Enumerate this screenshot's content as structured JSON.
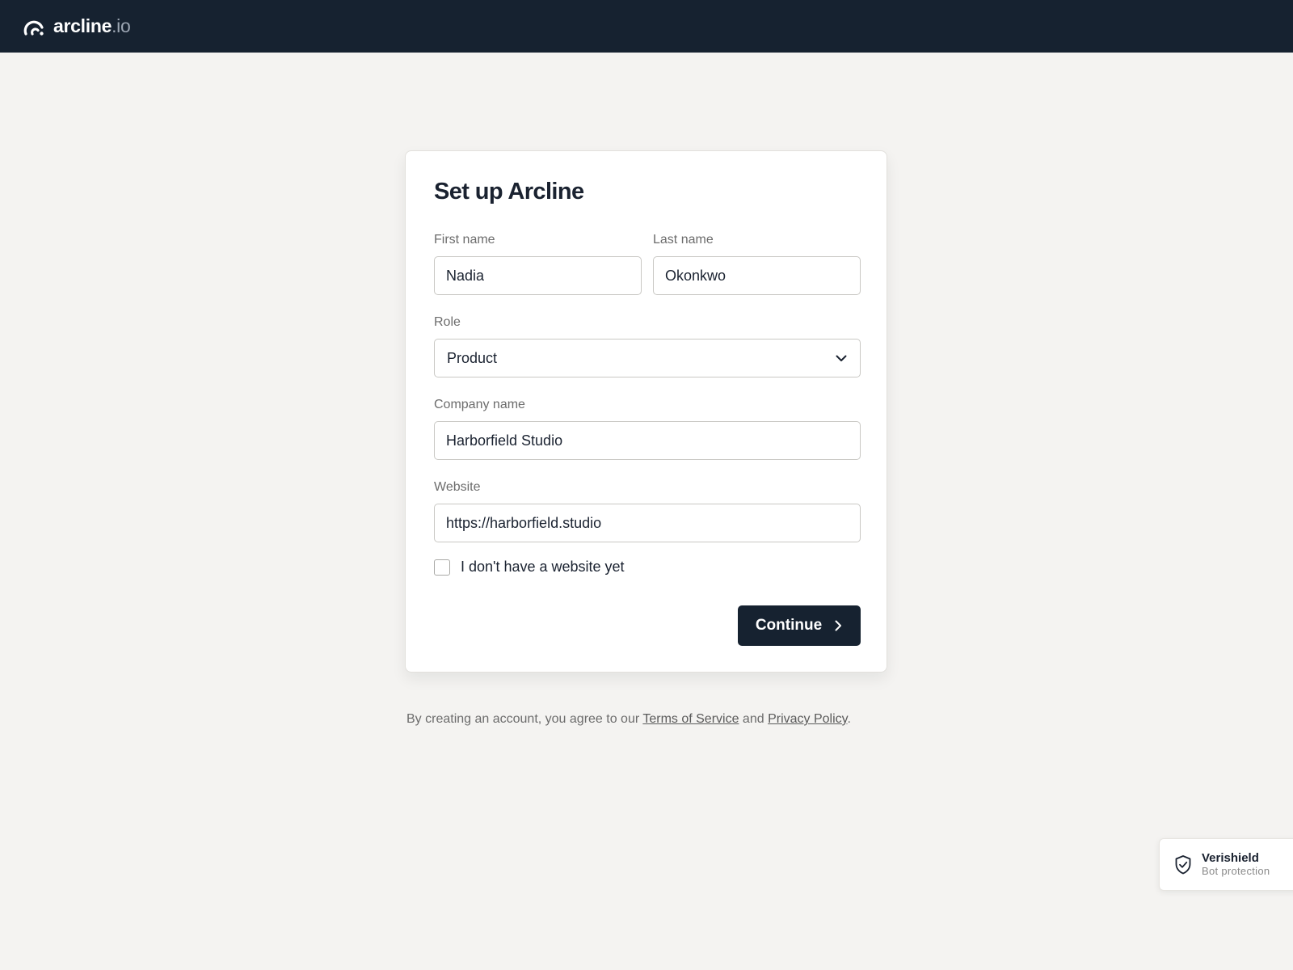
{
  "header": {
    "brand_name": "arcline",
    "brand_tld": ".io"
  },
  "form": {
    "title": "Set up Arcline",
    "first_name": {
      "label": "First name",
      "value": "Nadia"
    },
    "last_name": {
      "label": "Last name",
      "value": "Okonkwo"
    },
    "role": {
      "label": "Role",
      "selected": "Product"
    },
    "company": {
      "label": "Company name",
      "value": "Harborfield Studio"
    },
    "website": {
      "label": "Website",
      "value": "https://harborfield.studio"
    },
    "no_website": {
      "label": "I don't have a website yet",
      "checked": false
    },
    "continue_label": "Continue"
  },
  "legal": {
    "prefix": "By creating an account, you agree to our ",
    "terms": "Terms of Service",
    "and": " and ",
    "privacy": "Privacy Policy",
    "suffix": "."
  },
  "badge": {
    "title": "Verishield",
    "subtitle": "Bot protection"
  },
  "icons": {
    "logo": "arcline-logo-icon",
    "chevron": "chevron-down-icon",
    "arrow": "chevron-right-icon",
    "shield": "shield-check-icon"
  },
  "colors": {
    "topbar": "#162230",
    "background": "#f4f3f1",
    "button": "#162230"
  }
}
